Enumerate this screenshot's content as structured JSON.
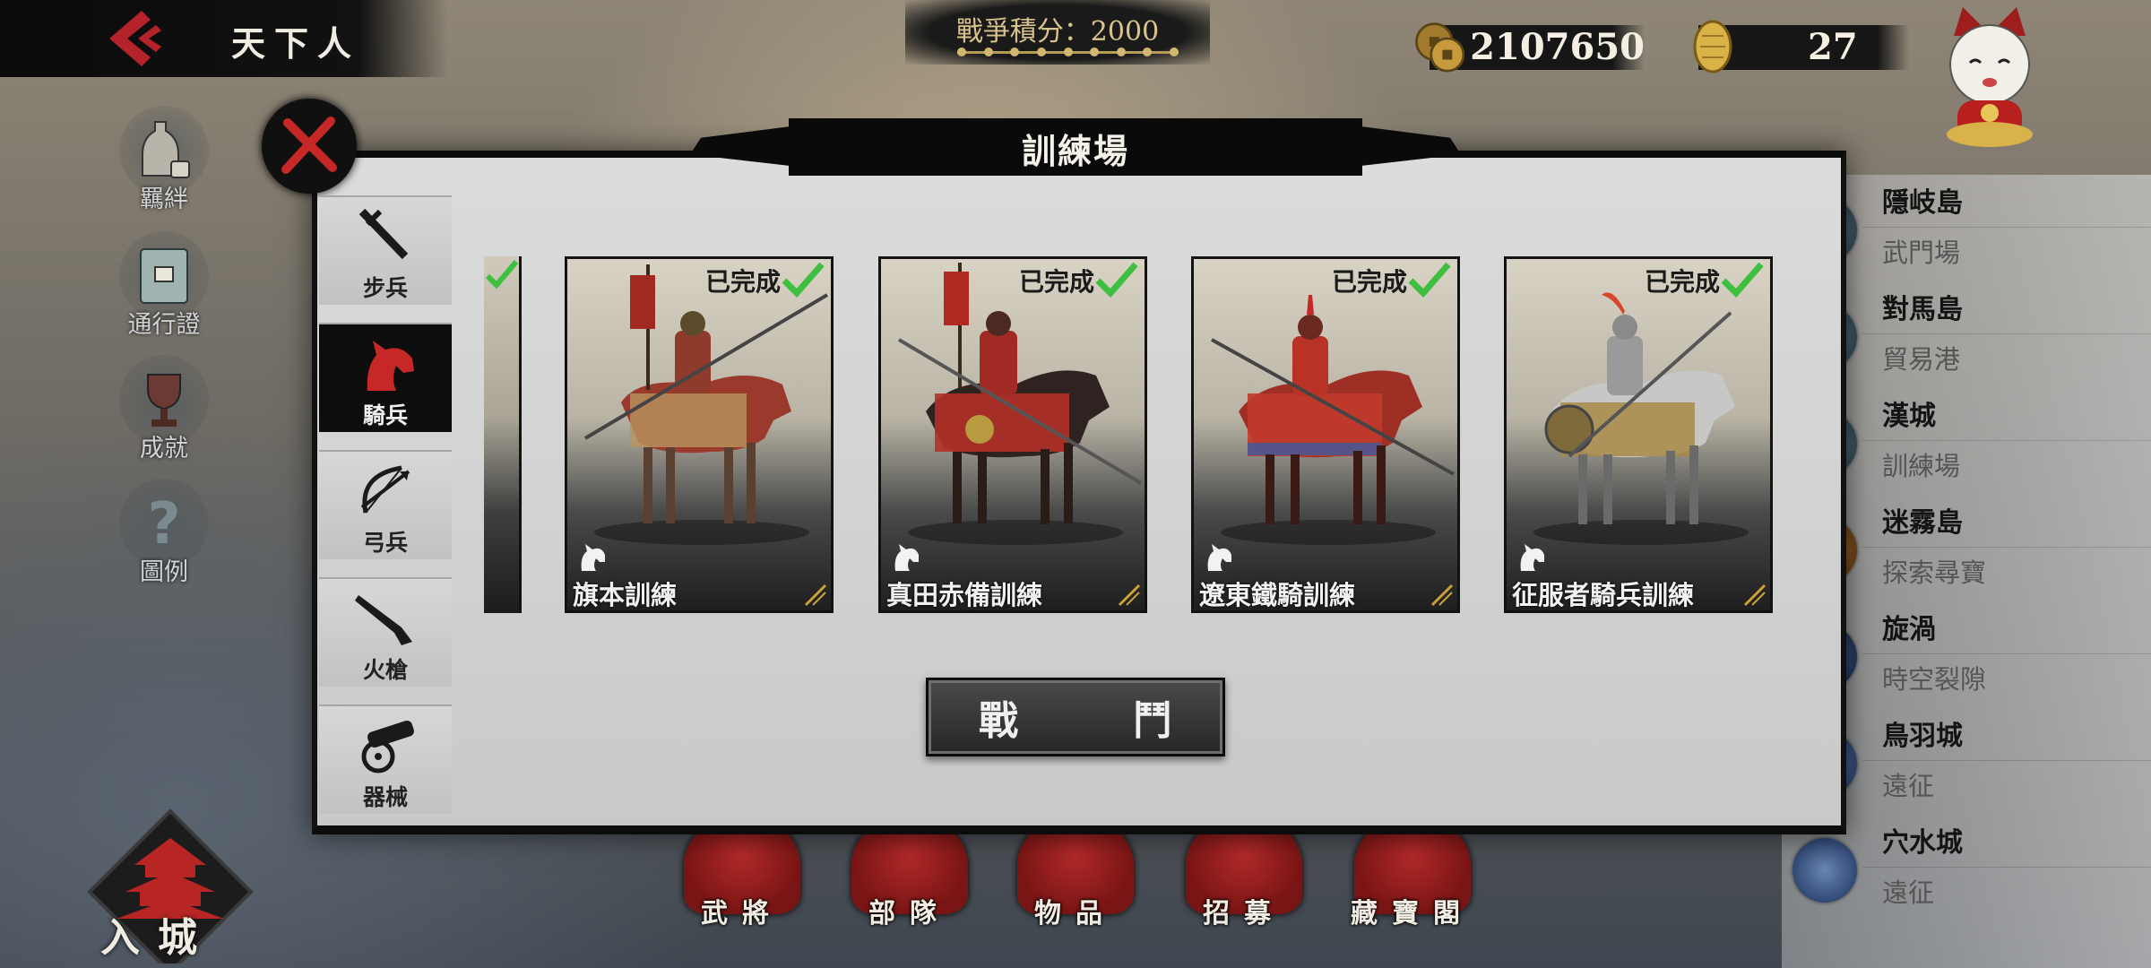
{
  "header": {
    "title": "天下人",
    "war_score": "戰爭積分：2000",
    "coins": "2107650",
    "gold": "27"
  },
  "side_menu": [
    {
      "label": "羈絆",
      "icon": "sake-set-icon"
    },
    {
      "label": "通行證",
      "icon": "pass-scroll-icon"
    },
    {
      "label": "成就",
      "icon": "trophy-icon"
    },
    {
      "label": "圖例",
      "icon": "question-icon"
    }
  ],
  "castle_button": {
    "label": "入城"
  },
  "bottom_menu": [
    {
      "label": "武將",
      "icon": "general-icon"
    },
    {
      "label": "部隊",
      "icon": "troops-banner-icon"
    },
    {
      "label": "物品",
      "icon": "fan-icon"
    },
    {
      "label": "招募",
      "icon": "samurai-helmet-icon"
    },
    {
      "label": "藏寶閣",
      "icon": "treasure-chest-icon"
    }
  ],
  "locations": [
    {
      "name": "隱岐島",
      "sub": "武門場"
    },
    {
      "name": "對馬島",
      "sub": "貿易港"
    },
    {
      "name": "漢城",
      "sub": "訓練場"
    },
    {
      "name": "迷霧島",
      "sub": "探索尋寶"
    },
    {
      "name": "旋渦",
      "sub": "時空裂隙"
    },
    {
      "name": "鳥羽城",
      "sub": "遠征"
    },
    {
      "name": "穴水城",
      "sub": "遠征"
    }
  ],
  "dialog": {
    "title": "訓練場",
    "fight_button": "戰　鬥",
    "tabs": [
      {
        "label": "步兵",
        "icon": "katana-icon",
        "active": false
      },
      {
        "label": "騎兵",
        "icon": "horse-head-icon",
        "active": true
      },
      {
        "label": "弓兵",
        "icon": "bow-arrow-icon",
        "active": false
      },
      {
        "label": "火槍",
        "icon": "musket-icon",
        "active": false
      },
      {
        "label": "器械",
        "icon": "cannon-icon",
        "active": false
      }
    ],
    "cards": [
      {
        "name": "旗本訓練",
        "status": "已完成",
        "colors": {
          "armor": "#8e3b2c",
          "horse": "#9a3a2c",
          "cloth": "#b89560"
        }
      },
      {
        "name": "真田赤備訓練",
        "status": "已完成",
        "colors": {
          "armor": "#a12b24",
          "horse": "#2e2320",
          "cloth": "#b23128"
        }
      },
      {
        "name": "遼東鐵騎訓練",
        "status": "已完成",
        "colors": {
          "armor": "#b83226",
          "horse": "#9e2f25",
          "cloth": "#c13a2c"
        }
      },
      {
        "name": "征服者騎兵訓練",
        "status": "已完成",
        "colors": {
          "armor": "#9a9a9a",
          "horse": "#c7c7c7",
          "cloth": "#a88846"
        }
      }
    ]
  },
  "colors": {
    "accent_red": "#b22222",
    "check_green": "#3fbf3f",
    "panel": "#d2d2d2"
  }
}
